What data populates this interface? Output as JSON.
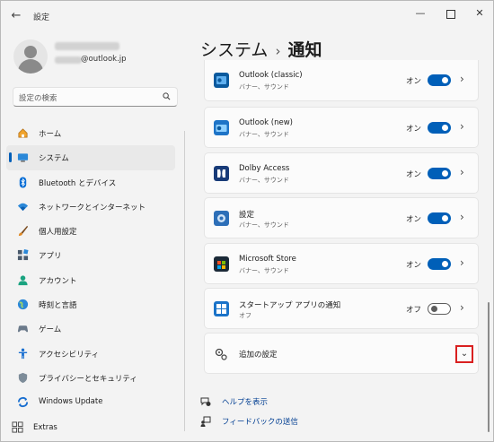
{
  "window": {
    "title": "設定"
  },
  "account": {
    "email_visible": "@outlook.jp"
  },
  "search": {
    "placeholder": "設定の検索"
  },
  "nav": [
    {
      "label": "ホーム",
      "icon": "home-icon"
    },
    {
      "label": "システム",
      "icon": "system-icon",
      "active": true
    },
    {
      "label": "Bluetooth とデバイス",
      "icon": "bluetooth-icon"
    },
    {
      "label": "ネットワークとインターネット",
      "icon": "wifi-icon"
    },
    {
      "label": "個人用設定",
      "icon": "brush-icon"
    },
    {
      "label": "アプリ",
      "icon": "apps-icon"
    },
    {
      "label": "アカウント",
      "icon": "account-icon"
    },
    {
      "label": "時刻と言語",
      "icon": "globe-icon"
    },
    {
      "label": "ゲーム",
      "icon": "game-icon"
    },
    {
      "label": "アクセシビリティ",
      "icon": "accessibility-icon"
    },
    {
      "label": "プライバシーとセキュリティ",
      "icon": "shield-icon"
    },
    {
      "label": "Windows Update",
      "icon": "update-icon"
    },
    {
      "label": "Extras",
      "icon": "extras-icon"
    }
  ],
  "header": {
    "parent": "システム",
    "separator": "›",
    "current": "通知"
  },
  "apps": [
    {
      "name": "Outlook (classic)",
      "sub": "バナー、サウンド",
      "state": "オン",
      "on": true,
      "icon": "outlook-classic-icon"
    },
    {
      "name": "Outlook (new)",
      "sub": "バナー、サウンド",
      "state": "オン",
      "on": true,
      "icon": "outlook-new-icon"
    },
    {
      "name": "Dolby Access",
      "sub": "バナー、サウンド",
      "state": "オン",
      "on": true,
      "icon": "dolby-icon"
    },
    {
      "name": "設定",
      "sub": "バナー、サウンド",
      "state": "オン",
      "on": true,
      "icon": "settings-app-icon"
    },
    {
      "name": "Microsoft Store",
      "sub": "バナー、サウンド",
      "state": "オン",
      "on": true,
      "icon": "store-icon"
    },
    {
      "name": "スタートアップ アプリの通知",
      "sub": "オフ",
      "state": "オフ",
      "on": false,
      "icon": "startup-apps-icon"
    }
  ],
  "additional": {
    "label": "追加の設定"
  },
  "links": {
    "help": "ヘルプを表示",
    "feedback": "フィードバックの送信"
  },
  "colors": {
    "accent": "#005fb8",
    "highlight": "#d92020"
  }
}
